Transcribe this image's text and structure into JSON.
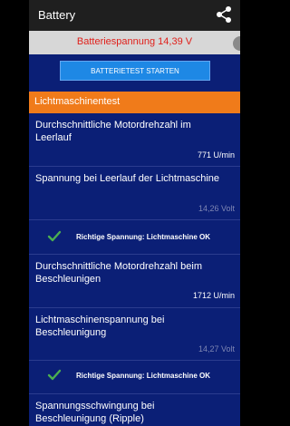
{
  "app": {
    "title": "Battery"
  },
  "battery": {
    "voltage_text": "Batteriespannung 14,39 V",
    "start_button": "BATTERIETEST STARTEN"
  },
  "section": {
    "title": "Lichtmaschinentest"
  },
  "measurements": [
    {
      "label": "Durchschnittliche Motordrehzahl im Leerlauf",
      "value": "771 U/min"
    },
    {
      "label": "Spannung bei Leerlauf der Lichtmaschine",
      "value": "14,26 Volt"
    },
    {
      "label": "Durchschnittliche Motordrehzahl beim Beschleunigen",
      "value": "1712 U/min"
    },
    {
      "label": "Lichtmaschinenspannung bei Beschleunigung",
      "value": "14,27 Volt"
    },
    {
      "label": "Spannungsschwingung bei Beschleunigung (Ripple)",
      "value": ""
    }
  ],
  "results": [
    {
      "text": "Richtige Spannung: Lichtmaschine OK"
    },
    {
      "text": "Richtige Spannung: Lichtmaschine OK"
    }
  ],
  "colors": {
    "accent": "#f07b1a",
    "background": "#0b1f76",
    "ok": "#4caf50",
    "voltage_text": "#e0201b",
    "button": "#1e88e5"
  },
  "icons": {
    "share": "share-icon",
    "check": "check-icon"
  }
}
